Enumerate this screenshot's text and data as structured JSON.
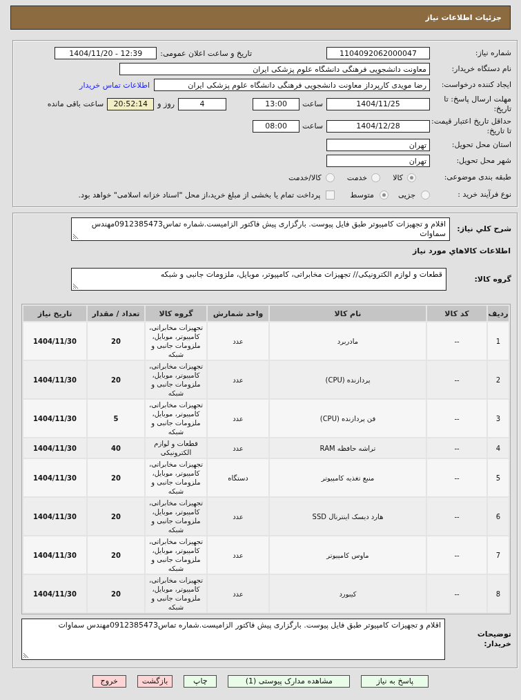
{
  "title": "جزئیات اطلاعات نیاز",
  "details": {
    "need_number": {
      "label": "شماره نیاز:",
      "value": "1104092062000047"
    },
    "announcement": {
      "label": "تاریخ و ساعت اعلان عمومی:",
      "value": "1404/11/20 - 12:39"
    },
    "buyer_organization": {
      "label": "نام دستگاه خریدار:",
      "value": "معاونت دانشجویی فرهنگی دانشگاه علوم پزشکی ایران"
    },
    "requester": {
      "label": "ایجاد کننده درخواست:",
      "value": "رضا مویدی کارپرداز معاونت دانشجویی فرهنگی دانشگاه علوم پزشکی ایران",
      "contact_link": "اطلاعات تماس خریدار"
    },
    "response_deadline": {
      "label": "مهلت ارسال پاسخ: تا تاریخ:",
      "date": "1404/11/25",
      "time_label": "ساعت",
      "time": "13:00",
      "days": "4",
      "days_label": "روز و",
      "remaining": "20:52:14",
      "remaining_label": "ساعت باقی مانده"
    },
    "price_validity": {
      "label": "حداقل تاریخ اعتبار قیمت: تا تاریخ:",
      "date": "1404/12/28",
      "time_label": "ساعت",
      "time": "08:00"
    },
    "delivery_province": {
      "label": "استان محل تحویل:",
      "value": "تهران"
    },
    "delivery_city": {
      "label": "شهر محل تحویل:",
      "value": "تهران"
    },
    "subject_category": {
      "label": "طبقه بندی موضوعی:",
      "options": [
        {
          "label": "کالا",
          "selected": true
        },
        {
          "label": "خدمت",
          "selected": false
        },
        {
          "label": "کالا/خدمت",
          "selected": false
        }
      ]
    },
    "purchase_process": {
      "label": "نوع فرآیند خرید :",
      "options": [
        {
          "label": "جزیی",
          "selected": false
        },
        {
          "label": "متوسط",
          "selected": true
        }
      ],
      "treasury_payment": {
        "label": "پرداخت تمام یا بخشی از مبلغ خرید،از محل \"اسناد خزانه اسلامی\" خواهد بود.",
        "checked": false
      }
    }
  },
  "needs": {
    "description": {
      "label": "شرح کلي نیاز:",
      "value": "اقلام و تجهیزات کامپیوتر طبق فایل پیوست. بارگزاری پیش فاکتور الزامیست.شماره تماس0912385473مهندس سماوات"
    },
    "goods_heading": "اطلاعات کالاهاي مورد نیاز",
    "goods_group": {
      "label": "گروه کالا:",
      "value": "قطعات و لوازم الکترونیکی// تجهیزات مخابراتی، کامپیوتر، موبایل، ملزومات جانبی و شبکه"
    },
    "table": {
      "columns": [
        "ردیف",
        "کد کالا",
        "نام کالا",
        "واحد شمارش",
        "گروه کالا",
        "تعداد / مقدار",
        "تاریخ نیاز"
      ],
      "rows": [
        {
          "row_number": "1",
          "code": "--",
          "name": "مادربرد",
          "unit": "عدد",
          "group": "تجهیزات مخابراتی، کامپیوتر، موبایل، ملزومات جانبی و شبکه",
          "quantity": "20",
          "need_date": "1404/11/30"
        },
        {
          "row_number": "2",
          "code": "--",
          "name": "پردازنده (CPU)",
          "unit": "عدد",
          "group": "تجهیزات مخابراتی، کامپیوتر، موبایل، ملزومات جانبی و شبکه",
          "quantity": "20",
          "need_date": "1404/11/30"
        },
        {
          "row_number": "3",
          "code": "--",
          "name": "فن پردازنده (CPU)",
          "unit": "عدد",
          "group": "تجهیزات مخابراتی، کامپیوتر، موبایل، ملزومات جانبی و شبکه",
          "quantity": "5",
          "need_date": "1404/11/30"
        },
        {
          "row_number": "4",
          "code": "--",
          "name": "تراشه حافظه RAM",
          "unit": "عدد",
          "group": "قطعات و لوازم الکترونیکی",
          "quantity": "40",
          "need_date": "1404/11/30"
        },
        {
          "row_number": "5",
          "code": "--",
          "name": "منبع تغذیه کامپیوتر",
          "unit": "دستگاه",
          "group": "تجهیزات مخابراتی، کامپیوتر، موبایل، ملزومات جانبی و شبکه",
          "quantity": "20",
          "need_date": "1404/11/30"
        },
        {
          "row_number": "6",
          "code": "--",
          "name": "هارد دیسک اینترنال SSD",
          "unit": "عدد",
          "group": "تجهیزات مخابراتی، کامپیوتر، موبایل، ملزومات جانبی و شبکه",
          "quantity": "20",
          "need_date": "1404/11/30"
        },
        {
          "row_number": "7",
          "code": "--",
          "name": "ماوس کامپیوتر",
          "unit": "عدد",
          "group": "تجهیزات مخابراتی، کامپیوتر، موبایل، ملزومات جانبی و شبکه",
          "quantity": "20",
          "need_date": "1404/11/30"
        },
        {
          "row_number": "8",
          "code": "--",
          "name": "کیبورد",
          "unit": "عدد",
          "group": "تجهیزات مخابراتی، کامپیوتر، موبایل، ملزومات جانبی و شبکه",
          "quantity": "20",
          "need_date": "1404/11/30"
        }
      ]
    },
    "buyer_notes": {
      "label": "توضیحات خریدار:",
      "value": "اقلام و تجهیزات کامپیوتر طبق فایل پیوست. بارگزاری پیش فاکتور الزامیست.شماره تماس0912385473مهندس سماوات"
    }
  },
  "buttons": [
    {
      "label": "پاسخ به نیاز",
      "kind": "action"
    },
    {
      "label": "مشاهده مدارک پیوستی (1)",
      "kind": "action"
    },
    {
      "label": "چاپ",
      "kind": "action"
    },
    {
      "label": "بازگشت",
      "kind": "exit"
    },
    {
      "label": "خروج",
      "kind": "exit"
    }
  ]
}
